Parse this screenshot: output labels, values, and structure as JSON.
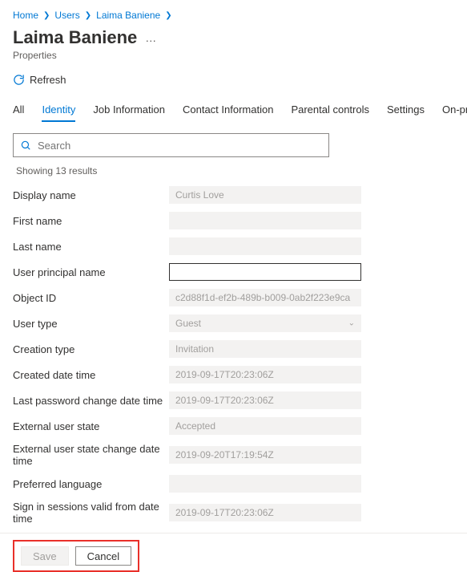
{
  "breadcrumb": {
    "home": "Home",
    "users": "Users",
    "current": "Laima Baniene"
  },
  "page": {
    "title": "Laima Baniene",
    "subtitle": "Properties",
    "refresh_label": "Refresh"
  },
  "tabs": {
    "all": "All",
    "identity": "Identity",
    "job": "Job Information",
    "contact": "Contact Information",
    "parental": "Parental controls",
    "settings": "Settings",
    "onprem": "On-premises"
  },
  "search": {
    "placeholder": "Search",
    "results_text": "Showing 13 results"
  },
  "fields": {
    "display_name": {
      "label": "Display name",
      "value": "Curtis Love"
    },
    "first_name": {
      "label": "First name",
      "value": ""
    },
    "last_name": {
      "label": "Last name",
      "value": ""
    },
    "upn": {
      "label": "User principal name",
      "value": ""
    },
    "object_id": {
      "label": "Object ID",
      "value": "c2d88f1d-ef2b-489b-b009-0ab2f223e9ca"
    },
    "user_type": {
      "label": "User type",
      "value": "Guest"
    },
    "creation_type": {
      "label": "Creation type",
      "value": "Invitation"
    },
    "created": {
      "label": "Created date time",
      "value": "2019-09-17T20:23:06Z"
    },
    "last_pw": {
      "label": "Last password change date time",
      "value": "2019-09-17T20:23:06Z"
    },
    "ext_state": {
      "label": "External user state",
      "value": "Accepted"
    },
    "ext_state_change": {
      "label": "External user state change date time",
      "value": "2019-09-20T17:19:54Z"
    },
    "pref_lang": {
      "label": "Preferred language",
      "value": ""
    },
    "sessions_valid": {
      "label": "Sign in sessions valid from date time",
      "value": "2019-09-17T20:23:06Z"
    }
  },
  "actions": {
    "save": "Save",
    "cancel": "Cancel"
  }
}
